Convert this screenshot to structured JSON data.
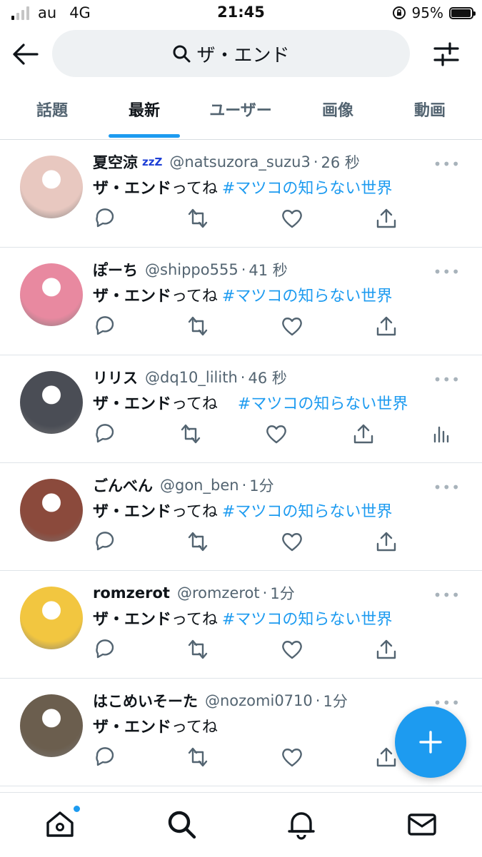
{
  "status_bar": {
    "carrier": "au",
    "network": "4G",
    "time": "21:45",
    "battery_percent": "95%",
    "battery_level": 0.95
  },
  "search": {
    "query": "ザ・エンド"
  },
  "tabs": [
    {
      "label": "話題",
      "active": false
    },
    {
      "label": "最新",
      "active": true
    },
    {
      "label": "ユーザー",
      "active": false
    },
    {
      "label": "画像",
      "active": false
    },
    {
      "label": "動画",
      "active": false
    }
  ],
  "tweets": [
    {
      "name": "夏空涼",
      "name_suffix": "zzZ",
      "handle": "@natsuzora_suzu3",
      "time": "26 秒",
      "bold_text": "ザ・エンド",
      "text": "ってね",
      "hashtag": "#マツコの知らない世界",
      "avatar_color": "#e8c8c0"
    },
    {
      "name": "ぽーち",
      "handle": "@shippo555",
      "time": "41 秒",
      "bold_text": "ザ・エンド",
      "text": "ってね",
      "hashtag": "#マツコの知らない世界",
      "avatar_color": "#e889a0"
    },
    {
      "name": "リリス",
      "handle": "@dq10_lilith",
      "time": "46 秒",
      "bold_text": "ザ・エンド",
      "text": "ってね　",
      "hashtag": "#マツコの知らない世界",
      "avatar_color": "#4a4d55",
      "has_analytics": true
    },
    {
      "name": "ごんべん",
      "handle": "@gon_ben",
      "time": "1分",
      "bold_text": "ザ・エンド",
      "text": "ってね",
      "hashtag": "#マツコの知らない世界",
      "avatar_color": "#8b4a3c"
    },
    {
      "name": "romzerot",
      "handle": "@romzerot",
      "time": "1分",
      "bold_text": "ザ・エンド",
      "text": "ってね",
      "hashtag": "#マツコの知らない世界",
      "avatar_color": "#f2c640"
    },
    {
      "name": "はこめいそーた",
      "handle": "@nozomi0710",
      "time": "1分",
      "bold_text": "ザ・エンド",
      "text": "ってね",
      "hashtag": "",
      "avatar_color": "#6b5e4e"
    }
  ],
  "icons": {
    "back": "arrow-left-icon",
    "search": "search-icon",
    "filter": "sliders-icon",
    "reply": "reply-icon",
    "retweet": "retweet-icon",
    "like": "heart-icon",
    "share": "share-icon",
    "analytics": "analytics-icon",
    "compose": "plus-icon",
    "nav": [
      "home-icon",
      "search-icon",
      "bell-icon",
      "mail-icon"
    ]
  },
  "colors": {
    "accent": "#1d9bf0",
    "secondary_text": "#536471",
    "divider": "#dfe4e8"
  }
}
